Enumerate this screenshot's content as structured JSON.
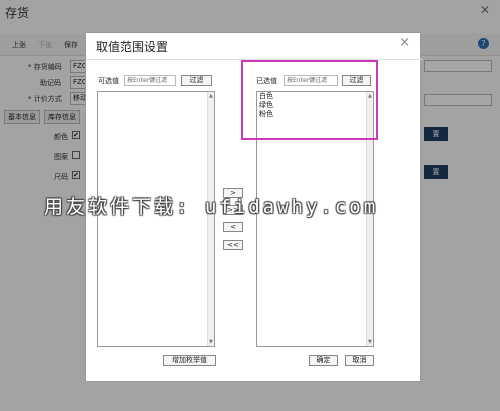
{
  "app": {
    "title": "存货",
    "toolbar": [
      "上张",
      "下张",
      "保存"
    ],
    "fields": [
      {
        "label": "* 存货编码",
        "value": "FZC"
      },
      {
        "label": "助记码",
        "value": "FZC"
      },
      {
        "label": "* 计价方式",
        "value": "移动"
      }
    ],
    "tabs": [
      "基本信息",
      "库存信息"
    ],
    "attributes": [
      {
        "label": "颜色",
        "checked": true
      },
      {
        "label": "图案",
        "checked": false
      },
      {
        "label": "尺码",
        "checked": true
      }
    ],
    "right_buttons": [
      "置",
      "置"
    ]
  },
  "dialog": {
    "title": "取值范围设置",
    "available": {
      "label": "可选值",
      "search_placeholder": "按Enter键过滤",
      "filter_button": "过滤",
      "items": [],
      "add_button": "增加枚举值"
    },
    "selected": {
      "label": "已选值",
      "search_placeholder": "按Enter键过滤",
      "filter_button": "过滤",
      "items": [
        "白色",
        "绿色",
        "粉色"
      ]
    },
    "move_buttons": [
      ">",
      ">>",
      "<",
      "<<"
    ],
    "ok_button": "确定",
    "cancel_button": "取消"
  },
  "watermark": "用友软件下载: ufidawhy.com",
  "colors": {
    "highlight": "#cc3ab8",
    "accent": "#1f3e66"
  }
}
